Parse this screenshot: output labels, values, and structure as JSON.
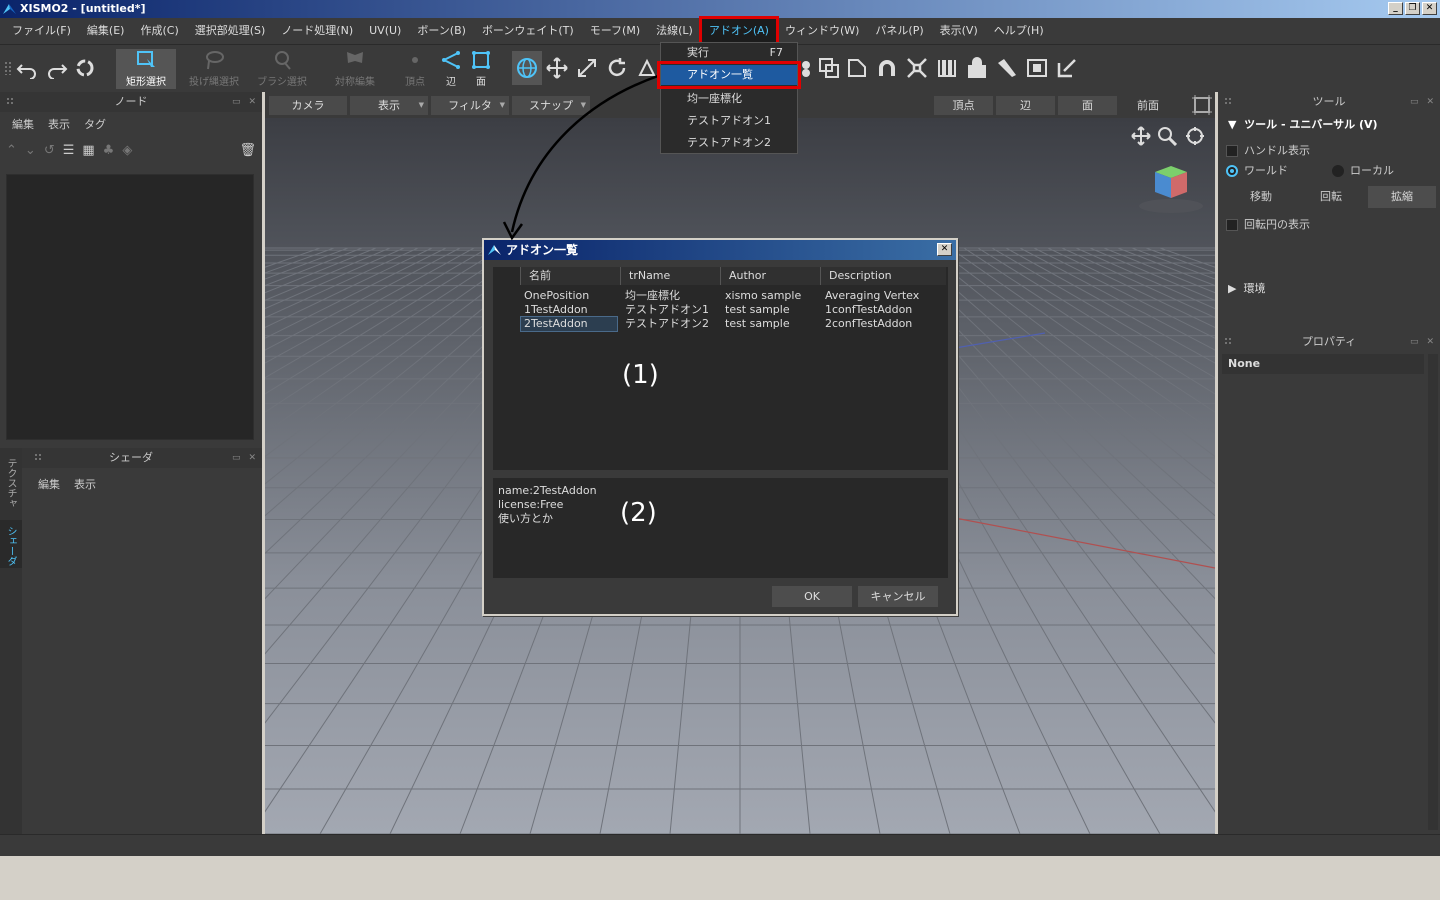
{
  "window": {
    "title": "XISMO2 - [untitled*]"
  },
  "menubar": [
    "ファイル(F)",
    "編集(E)",
    "作成(C)",
    "選択部処理(S)",
    "ノード処理(N)",
    "UV(U)",
    "ボーン(B)",
    "ボーンウェイト(T)",
    "モーフ(M)",
    "法線(L)",
    "アドオン(A)",
    "ウィンドウ(W)",
    "パネル(P)",
    "表示(V)",
    "ヘルプ(H)"
  ],
  "toolbar": {
    "rect_select": "矩形選択",
    "lasso_select": "投げ縄選択",
    "brush_select": "ブラシ選択",
    "symmetric_edit": "対称編集",
    "vertex": "頂点",
    "edge": "辺",
    "face": "面"
  },
  "addon_menu": {
    "items": [
      {
        "label": "実行",
        "shortcut": "F7"
      },
      {
        "label": "アドオン一覧",
        "shortcut": ""
      },
      {
        "label": "均一座標化",
        "shortcut": ""
      },
      {
        "label": "テストアドオン1",
        "shortcut": ""
      },
      {
        "label": "テストアドオン2",
        "shortcut": ""
      }
    ]
  },
  "node_panel": {
    "title": "ノード",
    "menu": [
      "編集",
      "表示",
      "タグ"
    ]
  },
  "shader_panel": {
    "title": "シェーダ",
    "menu": [
      "編集",
      "表示"
    ],
    "side_tabs": [
      "テクスチャ",
      "シェーダ"
    ]
  },
  "viewport_bar": {
    "left": [
      "カメラ",
      "表示",
      "フィルタ",
      "スナップ"
    ],
    "right": [
      "頂点",
      "辺",
      "面"
    ],
    "view_label": "前面"
  },
  "tool_panel": {
    "title": "ツール",
    "section": "ツール - ユニバーサル (V)",
    "handle_display": "ハンドル表示",
    "world": "ワールド",
    "local": "ローカル",
    "modes": [
      "移動",
      "回転",
      "拡縮"
    ],
    "rotation_circle": "回転円の表示",
    "environment": "環境"
  },
  "property_panel": {
    "title": "プロパティ",
    "value": "None"
  },
  "dialog": {
    "title": "アドオン一覧",
    "columns": [
      "名前",
      "trName",
      "Author",
      "Description"
    ],
    "rows": [
      [
        "OnePosition",
        "均一座標化",
        "xismo sample",
        "Averaging Vertex"
      ],
      [
        "1TestAddon",
        "テストアドオン1",
        "test sample",
        "1confTestAddon"
      ],
      [
        "2TestAddon",
        "テストアドオン2",
        "test sample",
        "2confTestAddon"
      ]
    ],
    "selected_row": 2,
    "info": [
      "name:2TestAddon",
      "license:Free",
      "使い方とか"
    ],
    "marker1": "(1)",
    "marker2": "(2)",
    "ok": "OK",
    "cancel": "キャンセル"
  },
  "colors": {
    "accent": "#4fc3f7",
    "highlight_box": "#e00000",
    "selection": "#1e5aa0"
  }
}
